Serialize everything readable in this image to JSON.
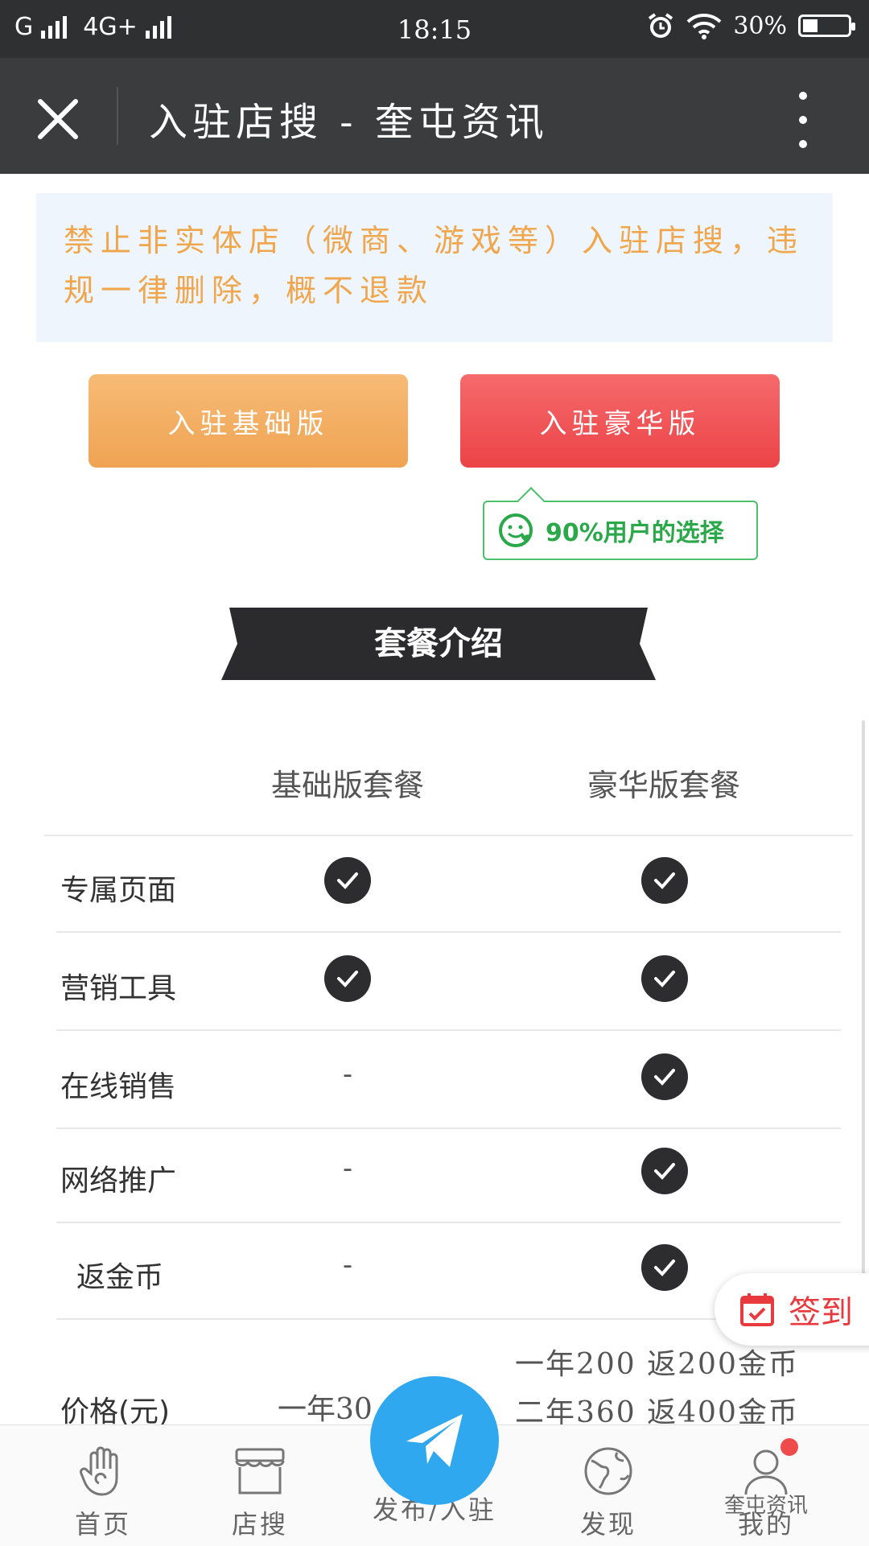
{
  "status_bar": {
    "carrier_1": "G",
    "carrier_2": "4G+",
    "time": "18:15",
    "battery": "30%"
  },
  "title_bar": {
    "title": "入驻店搜 - 奎屯资讯"
  },
  "notice": {
    "text": "禁止非实体店（微商、游戏等）入驻店搜，违规一律删除，概不退款"
  },
  "buttons": {
    "basic": "入驻基础版",
    "luxury": "入驻豪华版"
  },
  "badge": {
    "text": "90%用户的选择"
  },
  "section": {
    "title": "套餐介绍"
  },
  "table": {
    "col_basic": "基础版套餐",
    "col_luxury": "豪华版套餐",
    "rows": [
      {
        "label": "专属页面",
        "basic": "check",
        "luxury": "check"
      },
      {
        "label": "营销工具",
        "basic": "check",
        "luxury": "check"
      },
      {
        "label": "在线销售",
        "basic": "-",
        "luxury": "check"
      },
      {
        "label": "网络推广",
        "basic": "-",
        "luxury": "check"
      },
      {
        "label": "返金币",
        "basic": "-",
        "luxury": "check"
      }
    ],
    "price_label": "价格(元)",
    "price_basic": "一年30",
    "price_luxury_1": "一年200 返200金币",
    "price_luxury_2": "二年360 返400金币"
  },
  "signin": {
    "label": "签到"
  },
  "bottom_nav": {
    "home": "首页",
    "shops": "店搜",
    "publish": "发布/入驻",
    "discover": "发现",
    "mine": "我的"
  },
  "watermark": "奎屯资讯",
  "colors": {
    "notice_text": "#f0a64c",
    "basic_button": "#efa352",
    "luxury_button": "#ec4346",
    "badge_green": "#2aa84a",
    "publish_blue": "#2fa8ef",
    "signin_red": "#e83a3e"
  }
}
